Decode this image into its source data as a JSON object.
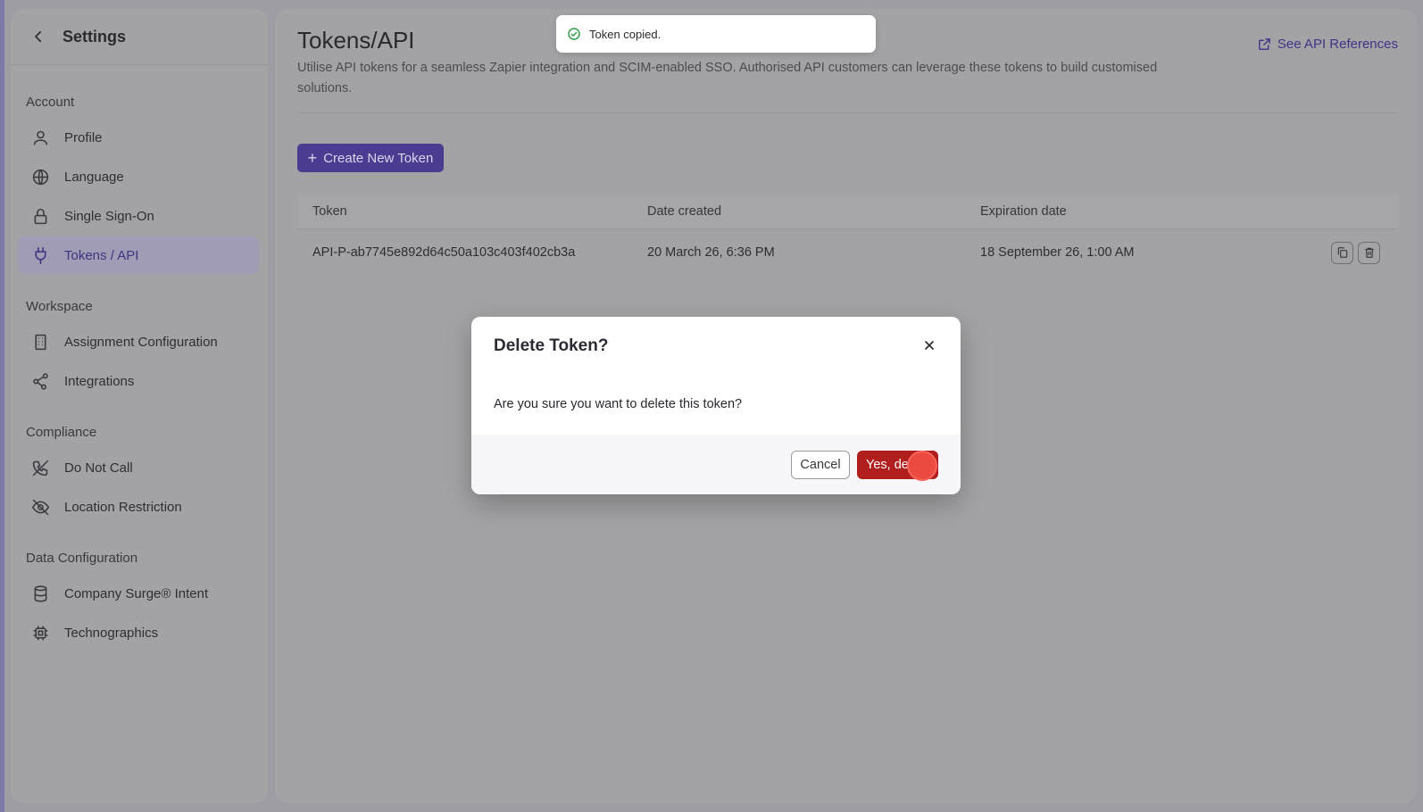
{
  "sidebar": {
    "title": "Settings",
    "sections": {
      "account": "Account",
      "workspace": "Workspace",
      "compliance": "Compliance",
      "data": "Data Configuration"
    },
    "items": {
      "profile": "Profile",
      "language": "Language",
      "sso": "Single Sign-On",
      "tokens": "Tokens / API",
      "assignment": "Assignment Configuration",
      "integrations": "Integrations",
      "dnc": "Do Not Call",
      "location": "Location Restriction",
      "surge": "Company Surge® Intent",
      "techno": "Technographics"
    }
  },
  "main": {
    "title": "Tokens/API",
    "api_link": "See API References",
    "description": "Utilise API tokens for a seamless Zapier integration and SCIM-enabled SSO. Authorised API customers can leverage these tokens to build customised solutions.",
    "create_button": "Create New Token",
    "table": {
      "headers": [
        "Token",
        "Date created",
        "Expiration date"
      ],
      "rows": [
        {
          "token": "API-P-ab7745e892d64c50a103c403f402cb3a",
          "created": "20 March 26, 6:36 PM",
          "expires": "18 September 26, 1:00 AM"
        }
      ]
    }
  },
  "toast": {
    "message": "Token copied."
  },
  "modal": {
    "title": "Delete Token?",
    "body": "Are you sure you want to delete this token?",
    "cancel": "Cancel",
    "confirm": "Yes, de"
  },
  "colors": {
    "accent": "#4b3c91",
    "danger": "#b01e1e",
    "success": "#2f9d49"
  }
}
